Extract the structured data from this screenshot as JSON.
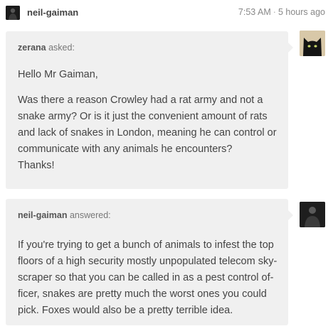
{
  "header": {
    "username": "neil-gaiman",
    "time": "7:53 AM",
    "separator": "·",
    "relative_time": "5 hours ago"
  },
  "question": {
    "asker": "zerana",
    "verb": " asked:",
    "greeting": "Hello Mr Gaiman,",
    "body": "Was there a reason Crowley had a rat army and not a snake army? Or is it just the convenient amount of rats and lack of snakes in London, meaning he can control or communicate with any animals he encounters?",
    "signoff": "Thanks!"
  },
  "answer": {
    "answerer": "neil-gaiman",
    "verb": " answered:",
    "body": "If you're trying to get a bunch of animals to infest the top floors of a high security mostly unpopulated telecom sky-scraper so that you can be called in as a pest control of-ficer, snakes are pretty much the worst ones you could pick. Foxes would also be a pretty terrible idea."
  },
  "colors": {
    "bubble_bg": "#f0f0f0",
    "text": "#444444",
    "muted": "#888888"
  }
}
